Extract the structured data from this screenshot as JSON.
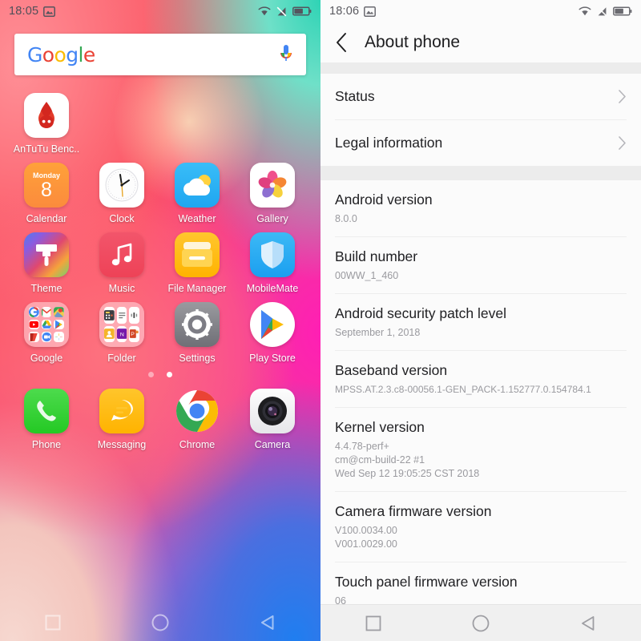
{
  "home": {
    "status_bar": {
      "time": "18:05",
      "icons": [
        "screenshot-icon",
        "wifi-icon",
        "no-signal-icon",
        "battery-icon"
      ]
    },
    "search": {
      "logo_letters": [
        "G",
        "o",
        "o",
        "g",
        "l",
        "e"
      ],
      "mic": "microphone-icon"
    },
    "rows": [
      {
        "apps": [
          {
            "label": "AnTuTu Benc..",
            "icon": "antutu-icon"
          }
        ]
      },
      {
        "apps": [
          {
            "label": "Calendar",
            "icon": "calendar-icon",
            "day": "Monday",
            "date": "8"
          },
          {
            "label": "Clock",
            "icon": "clock-icon"
          },
          {
            "label": "Weather",
            "icon": "weather-icon"
          },
          {
            "label": "Gallery",
            "icon": "gallery-icon"
          }
        ]
      },
      {
        "apps": [
          {
            "label": "Theme",
            "icon": "theme-icon"
          },
          {
            "label": "Music",
            "icon": "music-icon"
          },
          {
            "label": "File Manager",
            "icon": "file-manager-icon"
          },
          {
            "label": "MobileMate",
            "icon": "mobilemate-icon"
          }
        ]
      },
      {
        "apps": [
          {
            "label": "Google",
            "icon": "google-folder-icon"
          },
          {
            "label": "Folder",
            "icon": "folder-icon"
          },
          {
            "label": "Settings",
            "icon": "settings-icon"
          },
          {
            "label": "Play Store",
            "icon": "play-store-icon"
          }
        ]
      }
    ],
    "page_dots": {
      "count": 2,
      "active": 2
    },
    "dock": [
      {
        "label": "Phone",
        "icon": "phone-icon"
      },
      {
        "label": "Messaging",
        "icon": "messaging-icon"
      },
      {
        "label": "Chrome",
        "icon": "chrome-icon"
      },
      {
        "label": "Camera",
        "icon": "camera-icon"
      }
    ],
    "nav": [
      "recents-square-icon",
      "home-circle-icon",
      "back-triangle-icon"
    ]
  },
  "about": {
    "status_bar": {
      "time": "18:06",
      "icons": [
        "screenshot-icon",
        "wifi-icon",
        "no-signal-icon",
        "battery-icon"
      ]
    },
    "header": {
      "back": "back-chevron-icon",
      "title": "About phone"
    },
    "nav_items": [
      {
        "label": "Status",
        "chevron": "chevron-right-icon"
      },
      {
        "label": "Legal information",
        "chevron": "chevron-right-icon"
      }
    ],
    "info_items": [
      {
        "label": "Android version",
        "value": "8.0.0"
      },
      {
        "label": "Build number",
        "value": "00WW_1_460"
      },
      {
        "label": "Android security patch level",
        "value": "September 1, 2018"
      },
      {
        "label": "Baseband version",
        "value": "MPSS.AT.2.3.c8-00056.1-GEN_PACK-1.152777.0.154784.1"
      },
      {
        "label": "Kernel version",
        "value": "4.4.78-perf+\ncm@cm-build-22 #1\nWed Sep 12 19:05:25 CST 2018"
      },
      {
        "label": "Camera firmware version",
        "value": "V100.0034.00\nV001.0029.00"
      },
      {
        "label": "Touch panel firmware version",
        "value": "06"
      }
    ],
    "nav": [
      "recents-square-icon",
      "home-circle-icon",
      "back-triangle-icon"
    ]
  },
  "colors": {
    "accent_google_blue": "#4285F4",
    "accent_google_red": "#EA4335",
    "accent_google_yellow": "#FBBC05",
    "accent_google_green": "#34A853",
    "list_background": "#fbfbfb",
    "separator_band": "#ececec"
  }
}
